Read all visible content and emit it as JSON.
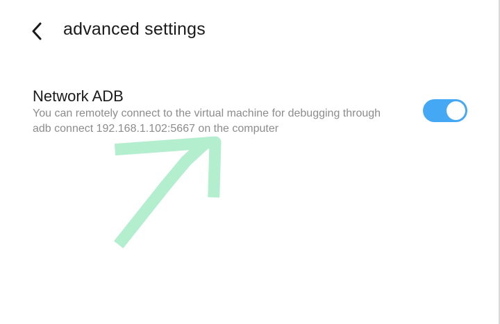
{
  "header": {
    "back_icon": "chevron-left-icon",
    "title": "advanced settings"
  },
  "network_adb": {
    "title": "Network ADB",
    "description": "You can remotely connect to the virtual machine for debugging through adb connect 192.168.1.102:5667 on the computer",
    "toggle_on": true,
    "toggle_color": "#45a8f5"
  },
  "annotation": {
    "type": "hand-drawn-arrow-icon",
    "color": "#b3efcf"
  }
}
